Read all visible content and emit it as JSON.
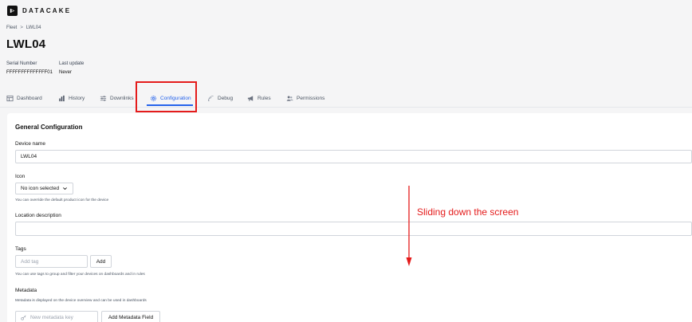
{
  "brand": {
    "logo_icon": "datacake-logo-icon",
    "name": "DATACAKE"
  },
  "breadcrumb": {
    "parent": "Fleet",
    "separator": ">",
    "current": "LWL04"
  },
  "device": {
    "title": "LWL04",
    "serial_label": "Serial Number",
    "serial_value": "FFFFFFFFFFFFFF01",
    "update_label": "Last update",
    "update_value": "Never"
  },
  "tabs": [
    {
      "label": "Dashboard",
      "icon": "dashboard-icon"
    },
    {
      "label": "History",
      "icon": "bar-chart-icon"
    },
    {
      "label": "Downlinks",
      "icon": "sliders-icon"
    },
    {
      "label": "Configuration",
      "icon": "gear-icon",
      "active": true
    },
    {
      "label": "Debug",
      "icon": "signal-icon"
    },
    {
      "label": "Rules",
      "icon": "megaphone-icon"
    },
    {
      "label": "Permissions",
      "icon": "users-icon"
    }
  ],
  "config": {
    "section_title": "General Configuration",
    "device_name_label": "Device name",
    "device_name_value": "LWL04",
    "icon_label": "Icon",
    "icon_select_value": "No icon selected",
    "icon_help": "You can override the default product icon for the device",
    "location_label": "Location description",
    "location_value": "",
    "tags_label": "Tags",
    "tags_placeholder": "Add tag",
    "tags_add_button": "Add",
    "tags_help": "You can use tags to group and filter your devices on dashboards and in rules",
    "metadata_label": "Metadata",
    "metadata_help": "Metadata is displayed on the device overview and can be used in dashboards",
    "metadata_key_placeholder": "New metadata key",
    "metadata_add_button": "Add Metadata Field"
  },
  "annotation": {
    "text": "Sliding down the screen",
    "color": "#e41b1b"
  },
  "colors": {
    "accent": "#2563eb",
    "annotation": "#e41b1b"
  }
}
